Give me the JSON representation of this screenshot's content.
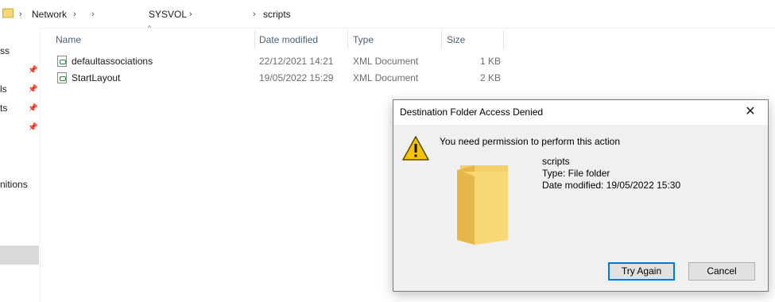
{
  "address": {
    "segments": [
      "Network",
      "",
      "SYSVOL",
      "scripts"
    ]
  },
  "nav": {
    "items": [
      "ss",
      "ls",
      "ts",
      "nitions"
    ]
  },
  "columns": {
    "name": "Name",
    "date_modified": "Date modified",
    "type": "Type",
    "size": "Size"
  },
  "files": [
    {
      "name": "defaultassociations",
      "date": "22/12/2021 14:21",
      "type": "XML Document",
      "size": "1 KB"
    },
    {
      "name": "StartLayout",
      "date": "19/05/2022 15:29",
      "type": "XML Document",
      "size": "2 KB"
    }
  ],
  "dialog": {
    "title": "Destination Folder Access Denied",
    "close_label": "✕",
    "message": "You need permission to perform this action",
    "folder_name": "scripts",
    "folder_type": "Type: File folder",
    "folder_modified": "Date modified: 19/05/2022 15:30",
    "try_again": "Try Again",
    "cancel": "Cancel"
  },
  "colors": {
    "accent": "#0078d7",
    "folder": "#f8d775",
    "warning": "#f5c500"
  }
}
